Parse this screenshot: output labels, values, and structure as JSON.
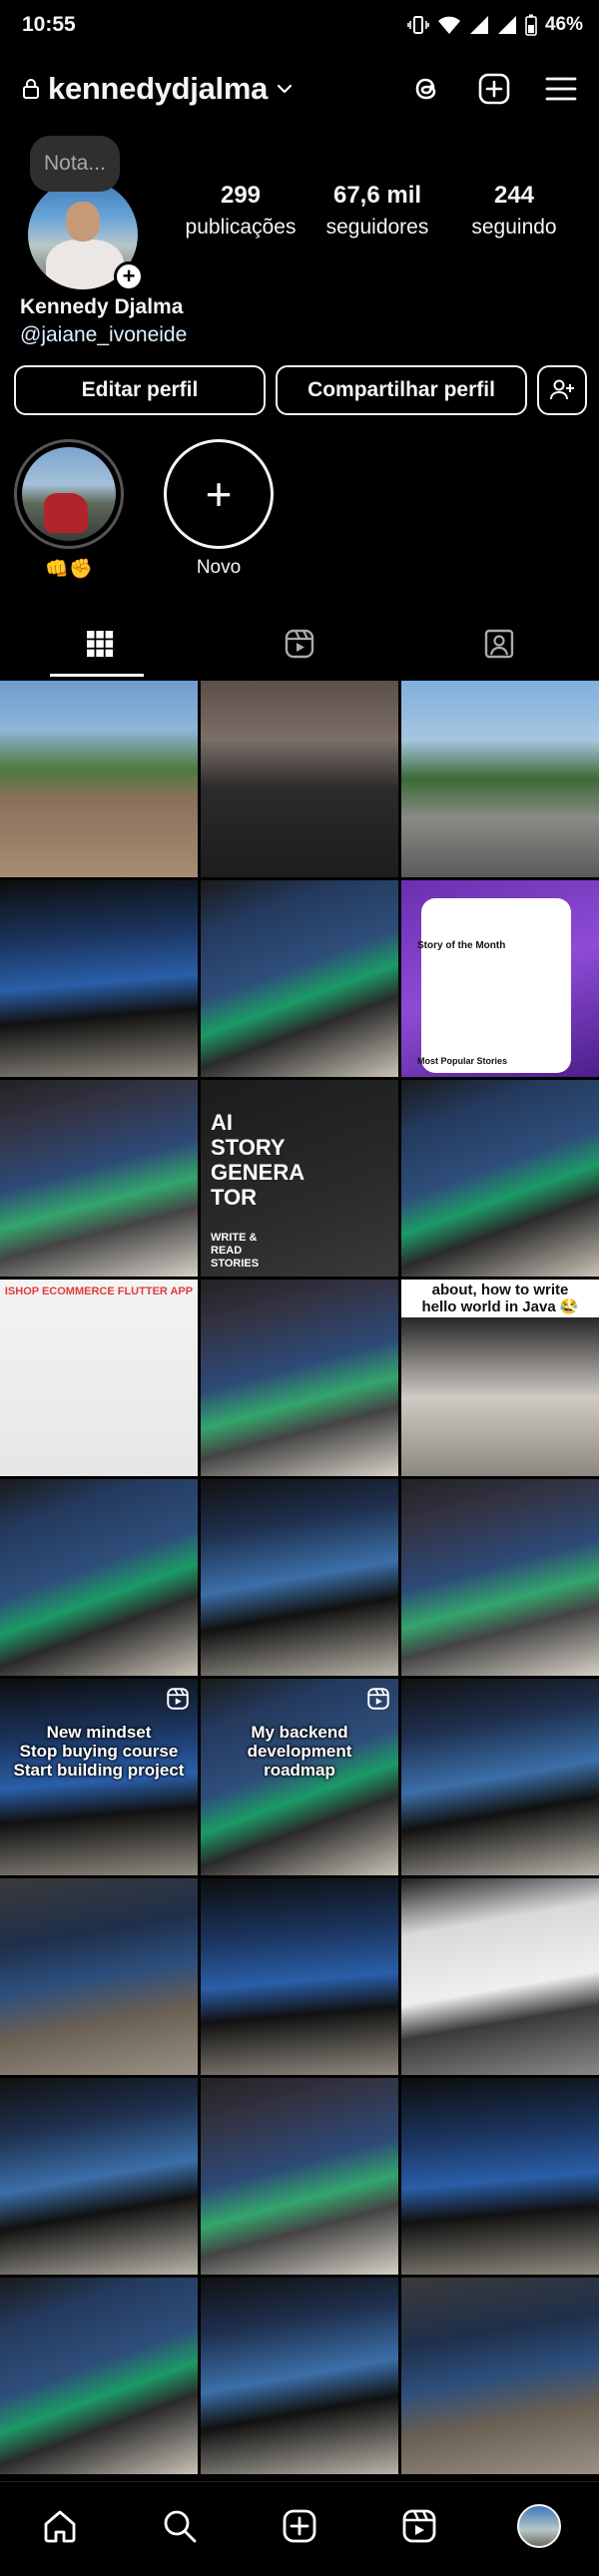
{
  "status_bar": {
    "time": "10:55",
    "battery": "46%"
  },
  "header": {
    "username": "kennedydjalma"
  },
  "profile": {
    "note": "Nota...",
    "display_name": "Kennedy Djalma",
    "handle": "@jaiane_ivoneide",
    "stats": [
      {
        "value": "299",
        "label": "publicações"
      },
      {
        "value": "67,6 mil",
        "label": "seguidores"
      },
      {
        "value": "244",
        "label": "seguindo"
      }
    ],
    "buttons": {
      "edit": "Editar perfil",
      "share": "Compartilhar perfil"
    }
  },
  "highlights": [
    {
      "label": "👊✊"
    },
    {
      "label": "Novo"
    }
  ],
  "tabs": [
    {
      "name": "grid",
      "icon": "grid-icon",
      "active": true
    },
    {
      "name": "reels",
      "icon": "reels-icon",
      "active": false
    },
    {
      "name": "tagged",
      "icon": "tagged-icon",
      "active": false
    }
  ],
  "posts": [
    {
      "kind": "photo-bike",
      "reel": false
    },
    {
      "kind": "photo-couple",
      "reel": false
    },
    {
      "kind": "photo-outdoor",
      "reel": false
    },
    {
      "kind": "monitor",
      "reel": false
    },
    {
      "kind": "monitor",
      "reel": false
    },
    {
      "kind": "app-story",
      "reel": false,
      "phone_title": "Story of the Month",
      "phone_footer": "Most Popular Stories"
    },
    {
      "kind": "monitor",
      "reel": false
    },
    {
      "kind": "ai-story",
      "reel": false,
      "title": "AI\nSTORY\nGENERA\nTOR",
      "subtitle": "WRITE &\nREAD\nSTORIES"
    },
    {
      "kind": "monitor",
      "reel": false
    },
    {
      "kind": "shop-app",
      "reel": false,
      "title": "ISHOP ECOMMERCE FLUTTER APP"
    },
    {
      "kind": "monitor",
      "reel": false
    },
    {
      "kind": "video-java",
      "reel": true,
      "caption": "about, how to write\nhello world in Java 😂"
    },
    {
      "kind": "monitor",
      "reel": false
    },
    {
      "kind": "monitor",
      "reel": false
    },
    {
      "kind": "monitor",
      "reel": false
    },
    {
      "kind": "monitor",
      "reel": true,
      "caption": "New mindset\nStop buying course\nStart building project"
    },
    {
      "kind": "monitor",
      "reel": true,
      "caption": "My backend\ndevelopment\nroadmap"
    },
    {
      "kind": "monitor",
      "reel": false
    },
    {
      "kind": "laptop",
      "reel": false
    },
    {
      "kind": "monitor",
      "reel": false
    },
    {
      "kind": "monitor-doc",
      "reel": false
    },
    {
      "kind": "monitor",
      "reel": false
    },
    {
      "kind": "monitor",
      "reel": false
    },
    {
      "kind": "monitor",
      "reel": false
    },
    {
      "kind": "monitor",
      "reel": false
    },
    {
      "kind": "monitor",
      "reel": false
    },
    {
      "kind": "laptop",
      "reel": false
    }
  ],
  "bottom_nav": [
    {
      "name": "home",
      "icon": "home-icon"
    },
    {
      "name": "search",
      "icon": "search-icon"
    },
    {
      "name": "create",
      "icon": "create-icon"
    },
    {
      "name": "reels",
      "icon": "reels-icon"
    },
    {
      "name": "profile",
      "icon": "profile-avatar"
    }
  ]
}
